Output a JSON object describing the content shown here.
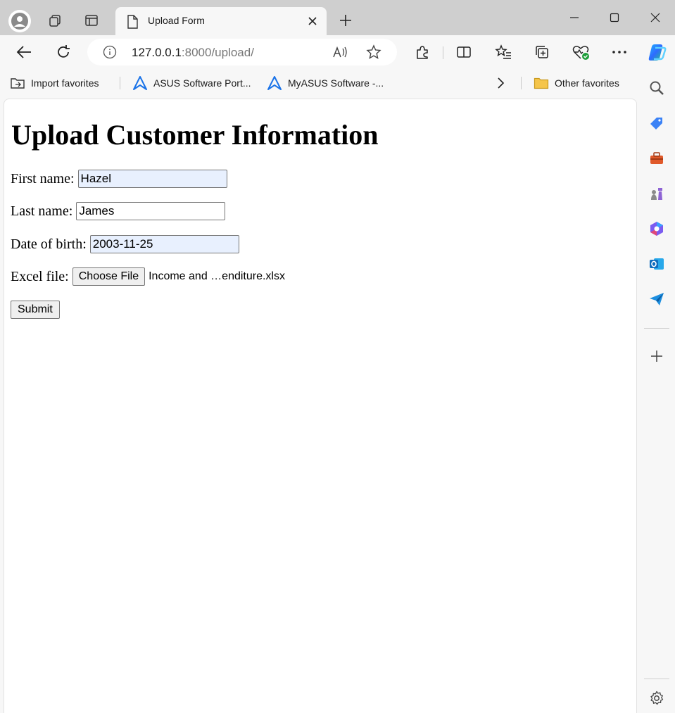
{
  "browser": {
    "tab_title": "Upload Form",
    "url_host": "127.0.0.1",
    "url_rest": ":8000/upload/"
  },
  "favorites": {
    "items": [
      {
        "label": "Import favorites",
        "icon": "import-favorites-icon"
      },
      {
        "label": "ASUS Software Port...",
        "icon": "asus-logo-icon"
      },
      {
        "label": "MyASUS Software -...",
        "icon": "asus-logo-icon"
      }
    ],
    "other": "Other favorites"
  },
  "page": {
    "heading": "Upload Customer Information",
    "first_name_label": "First name:",
    "first_name_value": "Hazel",
    "last_name_label": "Last name:",
    "last_name_value": "James",
    "dob_label": "Date of birth:",
    "dob_value": "2003-11-25",
    "file_label": "Excel file:",
    "choose_file_label": "Choose File",
    "file_name": "Income and …enditure.xlsx",
    "submit_label": "Submit"
  },
  "colors": {
    "autofill": "#e8f0fe",
    "chrome_bg": "#cfcfcf",
    "accent": "#1a73e8"
  }
}
